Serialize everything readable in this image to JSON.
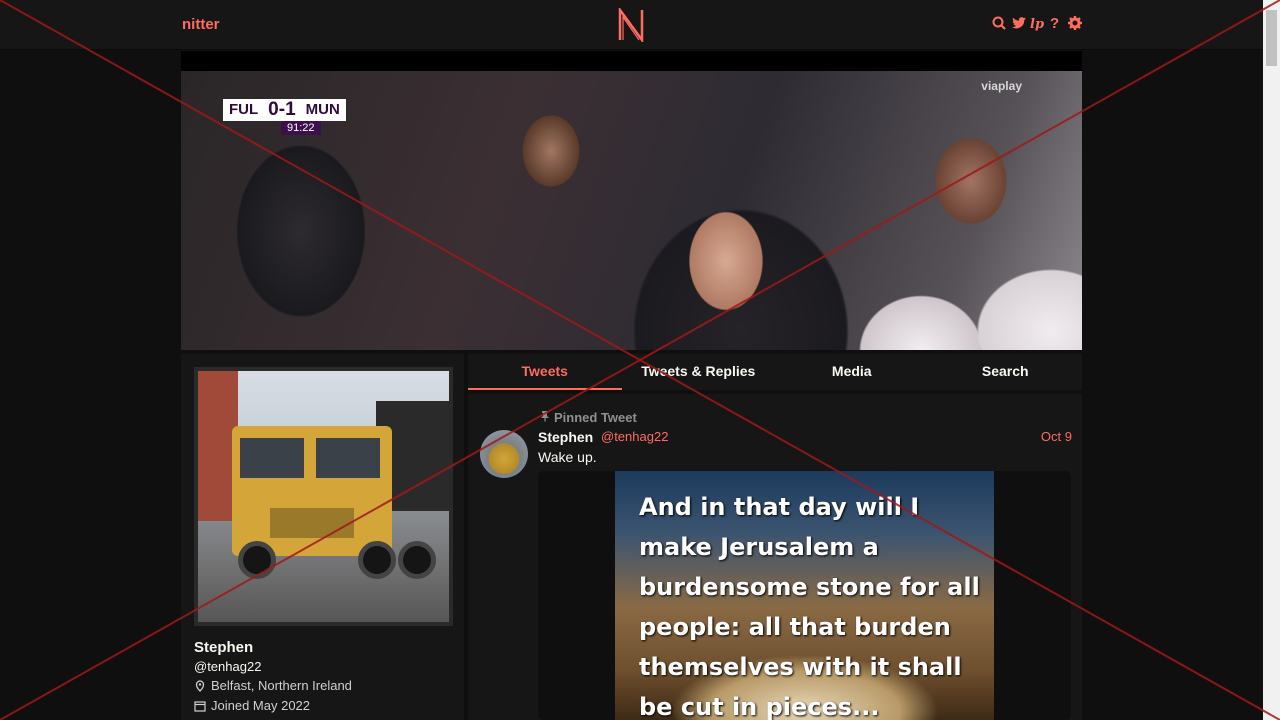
{
  "nav": {
    "brand": "nitter",
    "logo_letter": "N",
    "icons": [
      "search-icon",
      "twitter-icon",
      "rss-icon",
      "help-icon",
      "settings-icon"
    ]
  },
  "banner": {
    "team_home": "FUL",
    "score": "0-1",
    "team_away": "MUN",
    "match_time": "91:22",
    "broadcaster": "viaplay"
  },
  "profile": {
    "name": "Stephen",
    "handle": "@tenhag22",
    "location": "Belfast, Northern Ireland",
    "joined": "Joined May 2022"
  },
  "tabs": [
    {
      "label": "Tweets",
      "active": true
    },
    {
      "label": "Tweets & Replies",
      "active": false
    },
    {
      "label": "Media",
      "active": false
    },
    {
      "label": "Search",
      "active": false
    }
  ],
  "tweet": {
    "pinned_label": "Pinned Tweet",
    "author_name": "Stephen",
    "author_handle": "@tenhag22",
    "date": "Oct 9",
    "text": "Wake up.",
    "image_quote": "And in that day will I make Jerusalem a burdensome stone for all people: all that burden themselves with it shall be cut in pieces..."
  },
  "colors": {
    "accent": "#ff6c60",
    "background": "#0f0f0f",
    "panel": "#161616"
  }
}
